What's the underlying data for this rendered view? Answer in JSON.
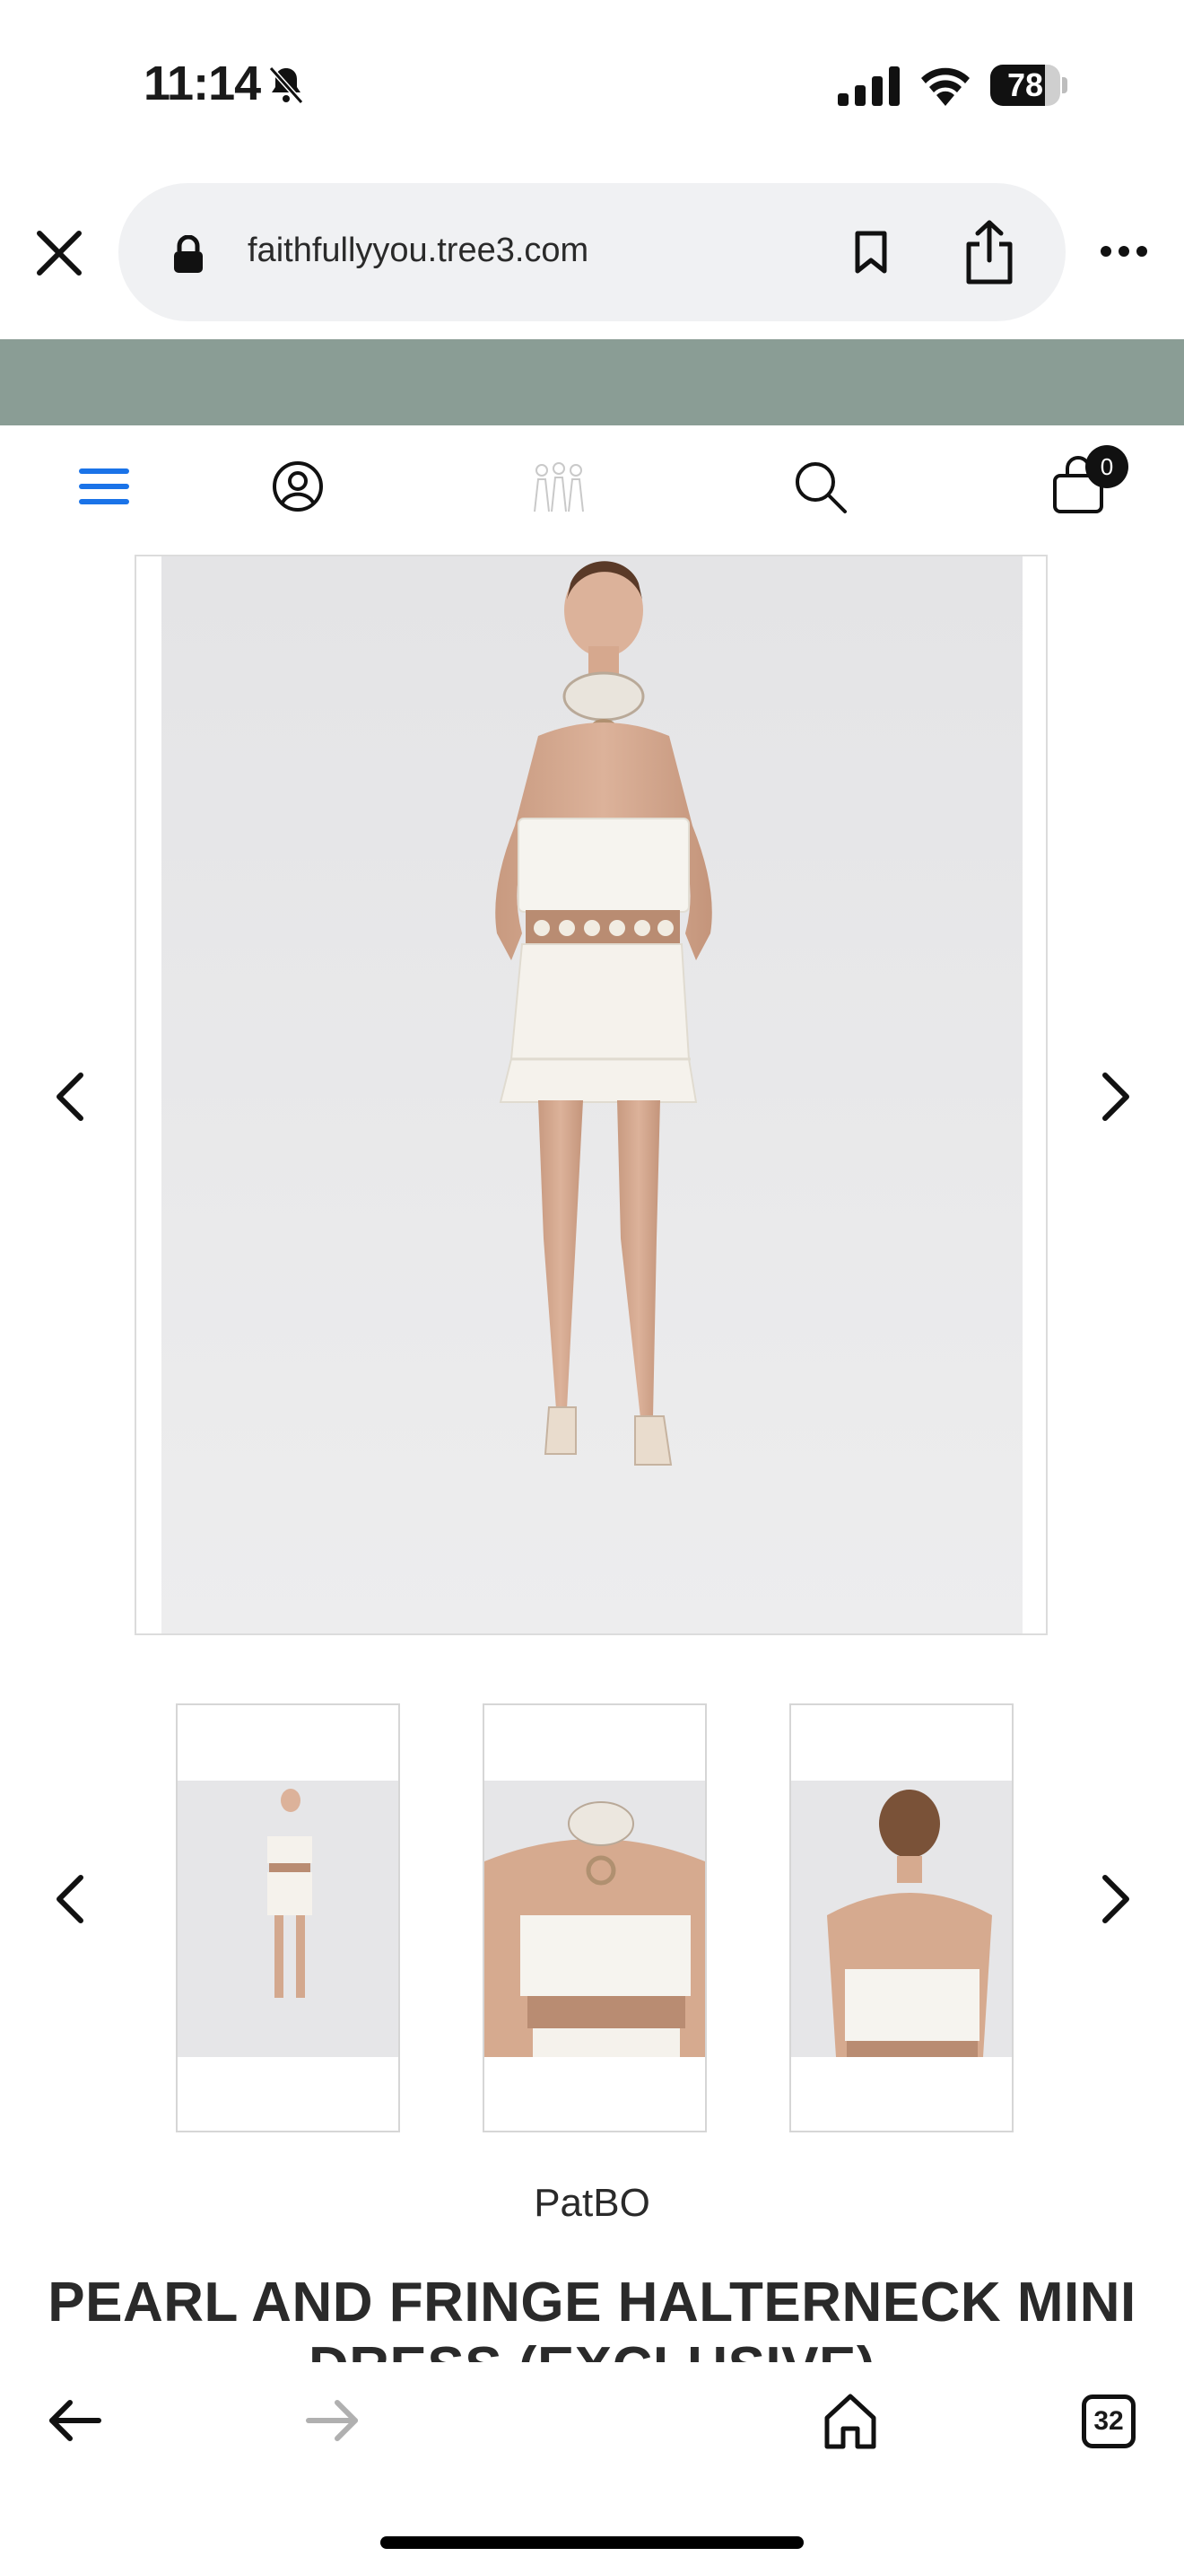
{
  "status_bar": {
    "time": "11:14",
    "battery_percent": "78",
    "battery_level": 0.78
  },
  "browser": {
    "url": "faithfullyyou.tree3.com",
    "tab_count": "32"
  },
  "header": {
    "cart_count": "0"
  },
  "product": {
    "brand": "PatBO",
    "title_line1": "PEARL AND FRINGE HALTERNECK MINI",
    "title_line2": "DRESS (EXCLUSIVE)"
  },
  "colors": {
    "banner": "#8a9d95",
    "menu_icon": "#1a73e8"
  },
  "icons": {
    "close": "close-icon",
    "lock": "lock-icon",
    "bookmark": "bookmark-icon",
    "share": "share-icon",
    "more": "more-icon",
    "menu": "hamburger-menu-icon",
    "account": "account-icon",
    "search": "search-icon",
    "cart": "shopping-bag-icon",
    "back": "back-arrow-icon",
    "forward": "forward-arrow-icon",
    "home": "home-icon"
  }
}
